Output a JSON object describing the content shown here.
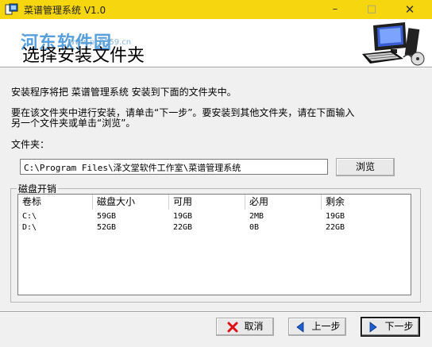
{
  "window": {
    "title": "菜谱管理系统 V1.0",
    "accent": "#f5d60f",
    "minimize": "–",
    "maximize": "□",
    "close": "✕"
  },
  "header": {
    "heading": "选择安装文件夹",
    "watermark": "河东软件园",
    "watermark_sub": "www.pc0359.cn"
  },
  "body": {
    "intro": "安装程序将把 菜谱管理系统 安装到下面的文件夹中。",
    "instruction_line1": "要在该文件夹中进行安装，请单击“下一步”。要安装到其他文件夹，请在下面输入",
    "instruction_line2": "另一个文件夹或单击“浏览”。",
    "folder_label": "文件夹：",
    "folder_path": "C:\\Program Files\\泽文堂软件工作室\\菜谱管理系统",
    "browse_label": "浏览"
  },
  "disk": {
    "group_label": "磁盘开销",
    "columns": [
      "卷标",
      "磁盘大小",
      "可用",
      "必用",
      "剩余"
    ],
    "rows": [
      [
        "C:\\",
        "59GB",
        "19GB",
        "2MB",
        "19GB"
      ],
      [
        "D:\\",
        "52GB",
        "22GB",
        "0B",
        "22GB"
      ]
    ]
  },
  "footer": {
    "cancel_label": "取消",
    "back_label": "上一步",
    "next_label": "下一步",
    "cancel_icon": "red-x-icon",
    "back_icon": "blue-left-arrow-icon",
    "next_icon": "blue-right-arrow-icon"
  }
}
